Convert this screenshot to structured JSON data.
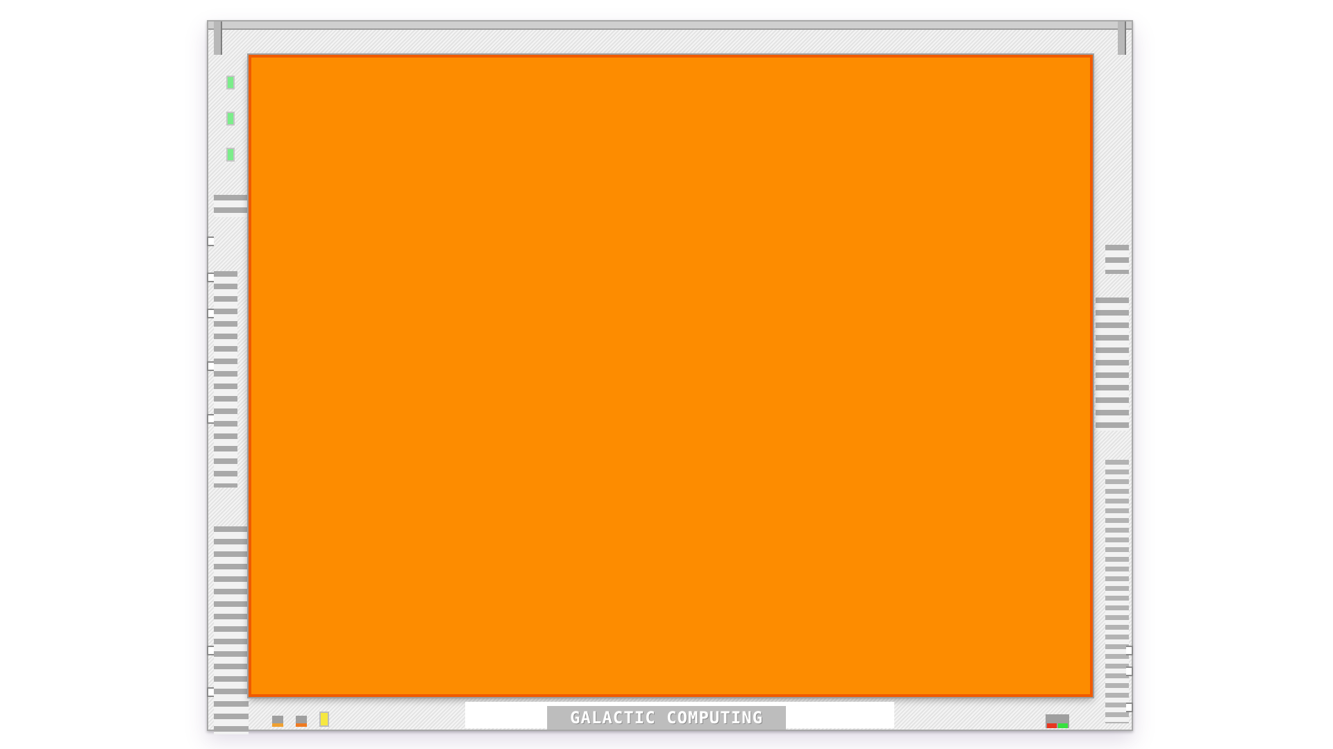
{
  "monitor": {
    "brand_label": "GALACTIC COMPUTING",
    "screen_color": "#fd8c00",
    "screen_border_color": "#f05a00",
    "indicator_leds": [
      {
        "name": "led-1",
        "color": "#7bed8a"
      },
      {
        "name": "led-2",
        "color": "#7bed8a"
      },
      {
        "name": "led-3",
        "color": "#7bed8a"
      }
    ],
    "bottom_buttons": [
      {
        "name": "button-1",
        "lamp_color": "#f0a030"
      },
      {
        "name": "button-2",
        "lamp_color": "#f07a20"
      }
    ],
    "power_lamp_color": "#f6e840",
    "status_lamps": {
      "left": "#e8361f",
      "right": "#37e03f"
    }
  }
}
